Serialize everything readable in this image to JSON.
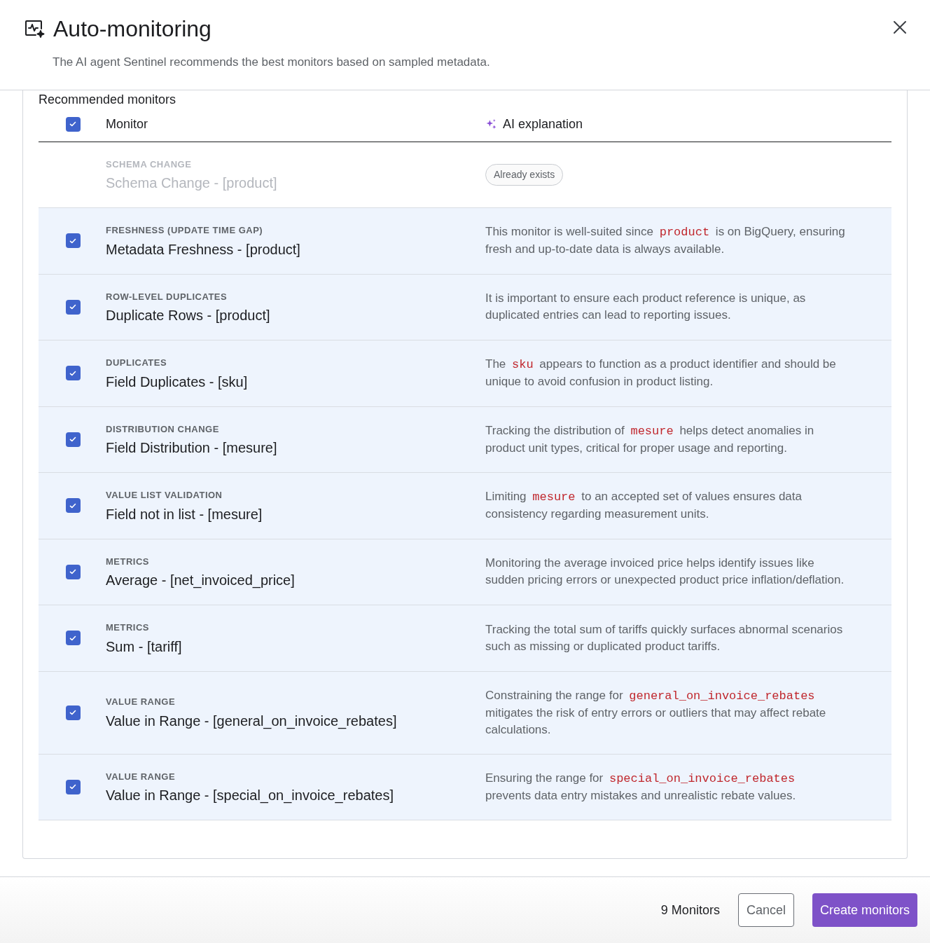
{
  "dialog": {
    "title": "Auto-monitoring",
    "subtitle": "The AI agent Sentinel recommends the best monitors based on sampled metadata."
  },
  "section_title": "Recommended monitors",
  "table": {
    "header": {
      "checked": true,
      "monitor": "Monitor",
      "explanation": "AI explanation"
    },
    "rows": [
      {
        "kind": "existing",
        "category": "SCHEMA CHANGE",
        "title": "Schema Change - [product]",
        "badge": "Already exists"
      },
      {
        "kind": "recommended",
        "checked": true,
        "category": "FRESHNESS (UPDATE TIME GAP)",
        "title": "Metadata Freshness - [product]",
        "explanation": [
          {
            "kind": "text",
            "text": "This monitor is well-suited since "
          },
          {
            "kind": "code",
            "text": "product"
          },
          {
            "kind": "text",
            "text": " is on BigQuery, ensuring fresh and up-to-date data is always available."
          }
        ]
      },
      {
        "kind": "recommended",
        "checked": true,
        "category": "ROW-LEVEL DUPLICATES",
        "title": "Duplicate Rows - [product]",
        "explanation": [
          {
            "kind": "text",
            "text": "It is important to ensure each product reference is unique, as duplicated entries can lead to reporting issues."
          }
        ]
      },
      {
        "kind": "recommended",
        "checked": true,
        "category": "DUPLICATES",
        "title": "Field Duplicates - [sku]",
        "explanation": [
          {
            "kind": "text",
            "text": "The "
          },
          {
            "kind": "code",
            "text": "sku"
          },
          {
            "kind": "text",
            "text": " appears to function as a product identifier and should be unique to avoid confusion in product listing."
          }
        ]
      },
      {
        "kind": "recommended",
        "checked": true,
        "category": "DISTRIBUTION CHANGE",
        "title": "Field Distribution - [mesure]",
        "explanation": [
          {
            "kind": "text",
            "text": "Tracking the distribution of "
          },
          {
            "kind": "code",
            "text": "mesure"
          },
          {
            "kind": "text",
            "text": " helps detect anomalies in product unit types, critical for proper usage and reporting."
          }
        ]
      },
      {
        "kind": "recommended",
        "checked": true,
        "category": "VALUE LIST VALIDATION",
        "title": "Field not in list - [mesure]",
        "explanation": [
          {
            "kind": "text",
            "text": "Limiting "
          },
          {
            "kind": "code",
            "text": "mesure"
          },
          {
            "kind": "text",
            "text": " to an accepted set of values ensures data consistency regarding measurement units."
          }
        ]
      },
      {
        "kind": "recommended",
        "checked": true,
        "category": "METRICS",
        "title": "Average - [net_invoiced_price]",
        "explanation": [
          {
            "kind": "text",
            "text": "Monitoring the average invoiced price helps identify issues like sudden pricing errors or unexpected product price inflation/deflation."
          }
        ]
      },
      {
        "kind": "recommended",
        "checked": true,
        "category": "METRICS",
        "title": "Sum - [tariff]",
        "explanation": [
          {
            "kind": "text",
            "text": "Tracking the total sum of tariffs quickly surfaces abnormal scenarios such as missing or duplicated product tariffs."
          }
        ]
      },
      {
        "kind": "recommended",
        "checked": true,
        "category": "VALUE RANGE",
        "title": "Value in Range - [general_on_invoice_rebates]",
        "explanation": [
          {
            "kind": "text",
            "text": "Constraining the range for "
          },
          {
            "kind": "code",
            "text": "general_on_invoice_rebates"
          },
          {
            "kind": "text",
            "text": " mitigates the risk of entry errors or outliers that may affect rebate calculations."
          }
        ]
      },
      {
        "kind": "recommended",
        "checked": true,
        "category": "VALUE RANGE",
        "title": "Value in Range - [special_on_invoice_rebates]",
        "explanation": [
          {
            "kind": "text",
            "text": "Ensuring the range for "
          },
          {
            "kind": "code",
            "text": "special_on_invoice_rebates"
          },
          {
            "kind": "text",
            "text": " prevents data entry mistakes and unrealistic rebate values."
          }
        ]
      }
    ]
  },
  "footer": {
    "count": "9 Monitors",
    "cancel": "Cancel",
    "create": "Create monitors"
  }
}
